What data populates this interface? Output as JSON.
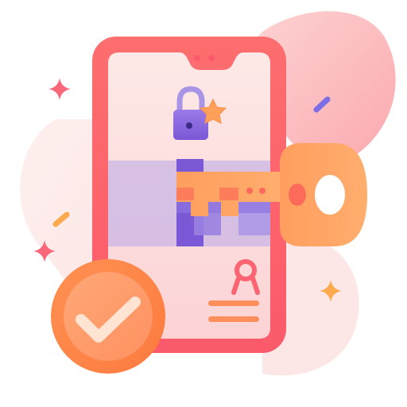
{
  "illustration": {
    "subject": "phone-key-security",
    "icons": [
      "phone-icon",
      "padlock-icon",
      "star-icon",
      "key-icon",
      "award-ribbon-icon",
      "checkmark-badge-icon",
      "sparkle-icon"
    ]
  },
  "colors": {
    "phone_frame": "#fb6a6a",
    "phone_screen": "#fde5e5",
    "blob_light": "#fde8e8",
    "blob_accent": "#fbb4b4",
    "purple": "#7b5bd6",
    "purple_light": "#a995e8",
    "key_orange": "#fd9c5b",
    "key_light": "#ffb27a",
    "check_badge": "#fd8a4a",
    "check_inner": "#ffb38a",
    "sparkle_red": "#f86a7a",
    "sparkle_orange": "#fdaa4f",
    "sparkle_purple": "#7d6ee6"
  }
}
